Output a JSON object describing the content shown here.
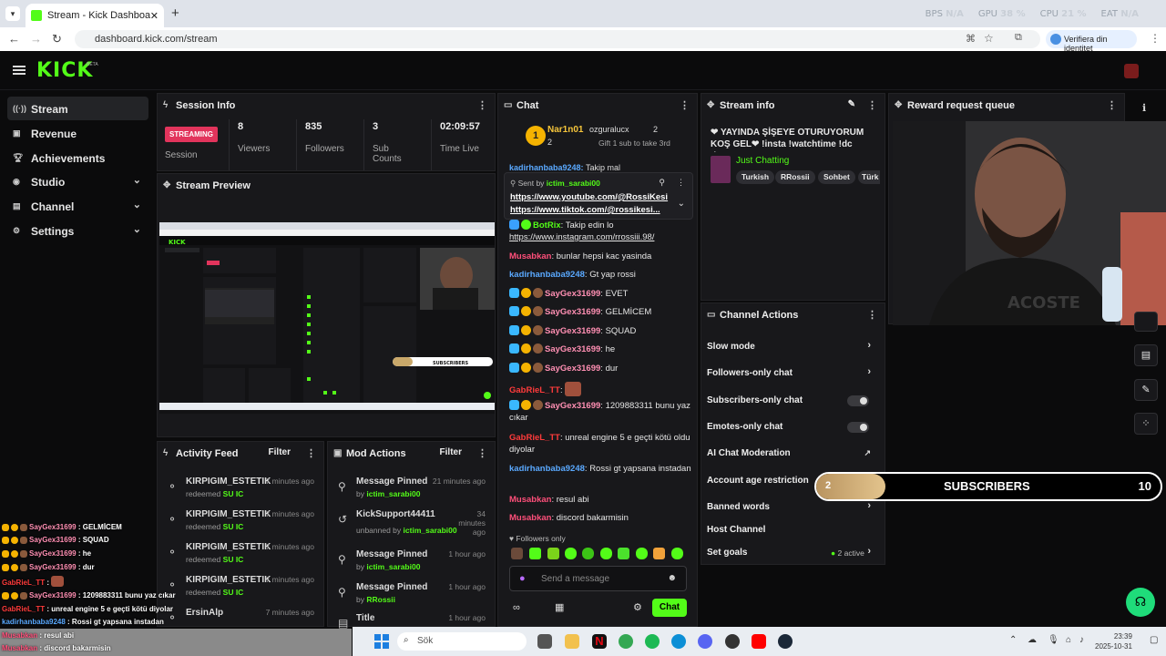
{
  "browser": {
    "tab_title": "Stream - Kick Dashboard",
    "new_tab": "+",
    "url": "dashboard.kick.com/stream",
    "identity": "Verifiera din identitet",
    "stats": [
      {
        "label": "BPS",
        "value": "N/A"
      },
      {
        "label": "GPU",
        "value": "38 %"
      },
      {
        "label": "CPU",
        "value": "21 %"
      },
      {
        "label": "EAT",
        "value": "N/A"
      }
    ]
  },
  "app": {
    "logo": "KICK",
    "beta": "BETA"
  },
  "sidebar": {
    "items": [
      {
        "label": "Stream",
        "icon": "broadcast-icon"
      },
      {
        "label": "Revenue",
        "icon": "revenue-icon"
      },
      {
        "label": "Achievements",
        "icon": "trophy-icon"
      },
      {
        "label": "Studio",
        "icon": "studio-icon"
      },
      {
        "label": "Channel",
        "icon": "channel-icon"
      },
      {
        "label": "Settings",
        "icon": "gear-icon"
      }
    ]
  },
  "session": {
    "title": "Session Info",
    "status": "STREAMING",
    "status_label": "Session",
    "viewers": "8",
    "viewers_label": "Viewers",
    "followers": "835",
    "followers_label": "Followers",
    "subs": "3",
    "subs_label": "Sub Counts",
    "time": "02:09:57",
    "time_label": "Time Live"
  },
  "preview": {
    "title": "Stream Preview"
  },
  "activity": {
    "title": "Activity Feed",
    "filter": "Filter",
    "items": [
      {
        "name": "KIRPIGIM_ESTETIK",
        "time": "7 minutes ago",
        "action": "redeemed",
        "item": "SU IC"
      },
      {
        "name": "KIRPIGIM_ESTETIK",
        "time": "7 minutes ago",
        "action": "redeemed",
        "item": "SU IC"
      },
      {
        "name": "KIRPIGIM_ESTETIK",
        "time": "7 minutes ago",
        "action": "redeemed",
        "item": "SU IC"
      },
      {
        "name": "KIRPIGIM_ESTETIK",
        "time": "7 minutes ago",
        "action": "redeemed",
        "item": "SU IC"
      },
      {
        "name": "ErsinAlp",
        "time": "7 minutes ago",
        "action": "",
        "item": ""
      }
    ]
  },
  "mod": {
    "title": "Mod Actions",
    "filter": "Filter",
    "items": [
      {
        "name": "Message Pinned",
        "time": "21 minutes ago",
        "by": "by",
        "user": "ictim_sarabi00"
      },
      {
        "name": "KickSupport44411",
        "time": "34 minutes ago",
        "by": "unbanned by",
        "user": "ictim_sarabi00"
      },
      {
        "name": "Message Pinned",
        "time": "1 hour ago",
        "by": "by",
        "user": "ictim_sarabi00"
      },
      {
        "name": "Message Pinned",
        "time": "1 hour ago",
        "by": "by",
        "user": "RRossii"
      },
      {
        "name": "Title",
        "time": "1 hour ago",
        "by": "",
        "user": ""
      }
    ]
  },
  "chat": {
    "title": "Chat",
    "top1_name": "Nar1n01",
    "top1_count": "2",
    "top2_name": "ozguralucx",
    "top2_count": "2",
    "gift_text": "Gift 1 sub to take 3rd",
    "partial_user": "kadirhanbaba9248",
    "partial_text": "Takip mal",
    "pinned_label": "Sent by",
    "pinned_user": "ictim_sarabi00",
    "pinned_line1": "https://www.youtube.com/@RossiKesi",
    "pinned_line2": "https://www.tiktok.com/@rossikesi...",
    "messages": [
      {
        "user": "BotRix",
        "color": "#53fc18",
        "text": "Takip edin lo"
      },
      {
        "user": "",
        "color": "#5aa9ff",
        "text": "https://www.instagram.com/rrossiii.98/"
      },
      {
        "user": "Musabkan",
        "color": "#ff4f7a",
        "text": "bunlar hepsi kac yasinda"
      },
      {
        "user": "kadirhanbaba9248",
        "color": "#5aa9ff",
        "text": "Gt yap rossi"
      },
      {
        "user": "SayGex31699",
        "color": "#ff8fb3",
        "text": "EVET"
      },
      {
        "user": "SayGex31699",
        "color": "#ff8fb3",
        "text": "GELMİCEM"
      },
      {
        "user": "SayGex31699",
        "color": "#ff8fb3",
        "text": "SQUAD"
      },
      {
        "user": "SayGex31699",
        "color": "#ff8fb3",
        "text": "he"
      },
      {
        "user": "SayGex31699",
        "color": "#ff8fb3",
        "text": "dur"
      },
      {
        "user": "GabRieL_TT",
        "color": "#ff3b3b",
        "text": ""
      },
      {
        "user": "SayGex31699",
        "color": "#ff8fb3",
        "text": "1209883311 bunu yaz cıkar"
      },
      {
        "user": "GabRieL_TT",
        "color": "#ff3b3b",
        "text": "unreal engine 5 e geçti kötü oldu diyolar"
      },
      {
        "user": "kadirhanbaba9248",
        "color": "#5aa9ff",
        "text": "Rossi gt yapsana instadan"
      },
      {
        "user": "Musabkan",
        "color": "#ff4f7a",
        "text": "resul abi"
      },
      {
        "user": "Musabkan",
        "color": "#ff4f7a",
        "text": "discord bakarmisin"
      }
    ],
    "followers_only": "Followers only",
    "placeholder": "Send a message",
    "send": "Chat"
  },
  "streaminfo": {
    "title": "Stream info",
    "stream_title": "❤ YAYINDA ŞİŞEYE OTURUYORUM KOŞ GEL❤ !insta !watchtime !dc !bag...",
    "category": "Just Chatting",
    "tags": [
      "Turkish",
      "RRossii",
      "Sohbet",
      "Türk"
    ]
  },
  "reward": {
    "title": "Reward request queue"
  },
  "actions": {
    "title": "Channel Actions",
    "items": [
      {
        "label": "Slow mode",
        "kind": "arrow"
      },
      {
        "label": "Followers-only chat",
        "kind": "arrow"
      },
      {
        "label": "Subscribers-only chat",
        "kind": "toggle"
      },
      {
        "label": "Emotes-only chat",
        "kind": "toggle"
      },
      {
        "label": "AI Chat Moderation",
        "kind": "ext"
      },
      {
        "label": "Account age restriction",
        "kind": "arrow"
      },
      {
        "label": "Banned words",
        "kind": "arrow"
      },
      {
        "label": "Host Channel",
        "kind": "none"
      },
      {
        "label": "Set goals",
        "kind": "goal",
        "extra": "2 active"
      }
    ]
  },
  "sub_goal": {
    "current": "2",
    "label": "SUBSCRIBERS",
    "target": "10",
    "progress": 0.2
  },
  "overlay": [
    {
      "user": "SayGex31699",
      "text": "GELMİCEM",
      "color": "#ff8fb3"
    },
    {
      "user": "SayGex31699",
      "text": "SQUAD",
      "color": "#ff8fb3"
    },
    {
      "user": "SayGex31699",
      "text": "he",
      "color": "#ff8fb3"
    },
    {
      "user": "SayGex31699",
      "text": "dur",
      "color": "#ff8fb3"
    },
    {
      "user": "GabRieL_TT",
      "text": "",
      "color": "#ff3b3b"
    },
    {
      "user": "SayGex31699",
      "text": "1209883311 bunu yaz cıkar",
      "color": "#ff8fb3"
    },
    {
      "user": "GabRieL_TT",
      "text": "unreal engine 5 e geçti kötü diyolar",
      "color": "#ff3b3b"
    },
    {
      "user": "kadirhanbaba9248",
      "text": "Rossi gt yapsana instadan",
      "color": "#5aa9ff"
    },
    {
      "user": "Musabkan",
      "text": "resul abi",
      "color": "#ff4f7a"
    },
    {
      "user": "Musabkan",
      "text": "discord bakarmisin",
      "color": "#ff4f7a"
    }
  ],
  "taskbar": {
    "search": "Sök",
    "time": "23:39",
    "date": "2025-10-31"
  }
}
